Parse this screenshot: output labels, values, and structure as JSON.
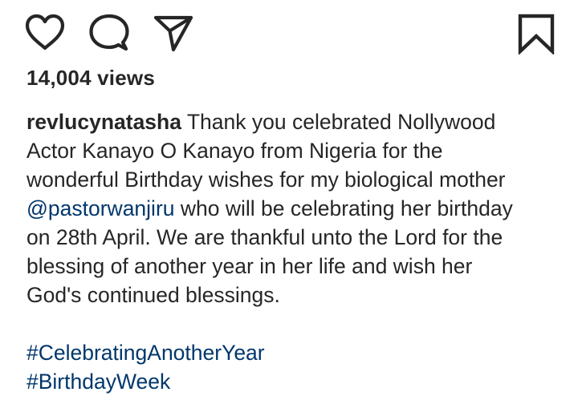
{
  "actions": {
    "like_icon": "heart-outline",
    "comment_icon": "speech-bubble-outline",
    "share_icon": "paper-plane-outline",
    "save_icon": "bookmark-outline"
  },
  "views": "14,004 views",
  "caption": {
    "username": "revlucynatasha",
    "text_1": "Thank you celebrated Nollywood",
    "line_2": "Actor Kanayo O Kanayo from Nigeria for the",
    "line_3": "wonderful Birthday wishes for my biological mother",
    "mention": "@pastorwanjiru",
    "text_4": "who will be celebrating her birthday",
    "line_5": "on 28th April. We are thankful unto the Lord for the",
    "line_6": "blessing of another year in her life and wish her",
    "line_7": "God's continued blessings.",
    "hashtags": [
      "#CelebratingAnotherYear",
      "#BirthdayWeek"
    ]
  },
  "colors": {
    "text": "#262626",
    "link": "#00376b",
    "background": "#ffffff"
  }
}
